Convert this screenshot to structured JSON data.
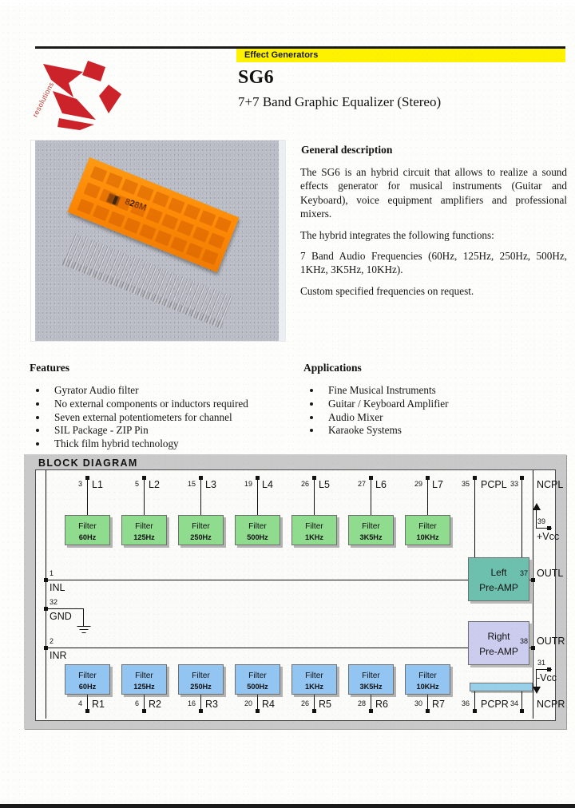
{
  "header": {
    "category_banner": "Effect Generators",
    "part_number": "SG6",
    "subtitle": "7+7 Band Graphic Equalizer (Stereo)",
    "logo_word": "resolutions"
  },
  "photo": {
    "module_marking": "828M"
  },
  "general_description": {
    "title": "General description",
    "paragraphs": [
      "The SG6 is an hybrid circuit that allows to realize a sound effects generator for musical instruments (Guitar and Keyboard), voice equipment amplifiers and professional mixers.",
      "The hybrid  integrates the following functions:",
      "7 Band Audio Frequencies (60Hz, 125Hz, 250Hz, 500Hz, 1KHz, 3K5Hz, 10KHz).",
      "Custom specified frequencies on request."
    ]
  },
  "features": {
    "title": "Features",
    "items": [
      "Gyrator Audio filter",
      "No external components or inductors required",
      "Seven external potentiometers for channel",
      "SIL Package - ZIP Pin",
      "Thick film hybrid technology"
    ]
  },
  "applications": {
    "title": "Applications",
    "items": [
      "Fine Musical Instruments",
      "Guitar / Keyboard Amplifier",
      "Audio Mixer",
      "Karaoke Systems"
    ]
  },
  "block_diagram": {
    "tab_label": "BLOCK DIAGRAM",
    "left_filters": [
      {
        "title": "Filter",
        "freq": "60Hz",
        "pin": "3",
        "label": "L1"
      },
      {
        "title": "Filter",
        "freq": "125Hz",
        "pin": "5",
        "label": "L2"
      },
      {
        "title": "Filter",
        "freq": "250Hz",
        "pin": "15",
        "label": "L3"
      },
      {
        "title": "Filter",
        "freq": "500Hz",
        "pin": "19",
        "label": "L4"
      },
      {
        "title": "Filter",
        "freq": "1KHz",
        "pin": "26",
        "label": "L5"
      },
      {
        "title": "Filter",
        "freq": "3K5Hz",
        "pin": "27",
        "label": "L6"
      },
      {
        "title": "Filter",
        "freq": "10KHz",
        "pin": "29",
        "label": "L7"
      }
    ],
    "right_filters": [
      {
        "title": "Filter",
        "freq": "60Hz",
        "pin": "4",
        "label": "R1"
      },
      {
        "title": "Filter",
        "freq": "125Hz",
        "pin": "6",
        "label": "R2"
      },
      {
        "title": "Filter",
        "freq": "250Hz",
        "pin": "16",
        "label": "R3"
      },
      {
        "title": "Filter",
        "freq": "500Hz",
        "pin": "20",
        "label": "R4"
      },
      {
        "title": "Filter",
        "freq": "1KHz",
        "pin": "26",
        "label": "R5"
      },
      {
        "title": "Filter",
        "freq": "3K5Hz",
        "pin": "28",
        "label": "R6"
      },
      {
        "title": "Filter",
        "freq": "10KHz",
        "pin": "30",
        "label": "R7"
      }
    ],
    "amps": {
      "left": {
        "line1": "Left",
        "line2": "Pre-AMP"
      },
      "right": {
        "line1": "Right",
        "line2": "Pre-AMP"
      }
    },
    "top_pins": [
      {
        "pin": "35",
        "label": "PCPL"
      },
      {
        "pin": "33",
        "label": "NCPL"
      }
    ],
    "bottom_pins": [
      {
        "pin": "36",
        "label": "PCPR"
      },
      {
        "pin": "34",
        "label": "NCPR"
      }
    ],
    "left_pins": [
      {
        "pin": "1",
        "label": "INL"
      },
      {
        "pin": "32",
        "label": "GND"
      },
      {
        "pin": "2",
        "label": "INR"
      }
    ],
    "right_pins": [
      {
        "pin": "39",
        "label": "+Vcc"
      },
      {
        "pin": "37",
        "label": "OUTL"
      },
      {
        "pin": "38",
        "label": "OUTR"
      },
      {
        "pin": "31",
        "label": "-Vcc"
      }
    ]
  },
  "colors": {
    "banner_yellow": "#fff200",
    "logo_red": "#cc2229",
    "filter_left_green": "#8fdc8f",
    "filter_right_blue": "#93c5f2",
    "amp_left_teal": "#6dbfae",
    "amp_right_lavender": "#ccccee",
    "diagram_frame_grey": "#c9c9c9"
  }
}
